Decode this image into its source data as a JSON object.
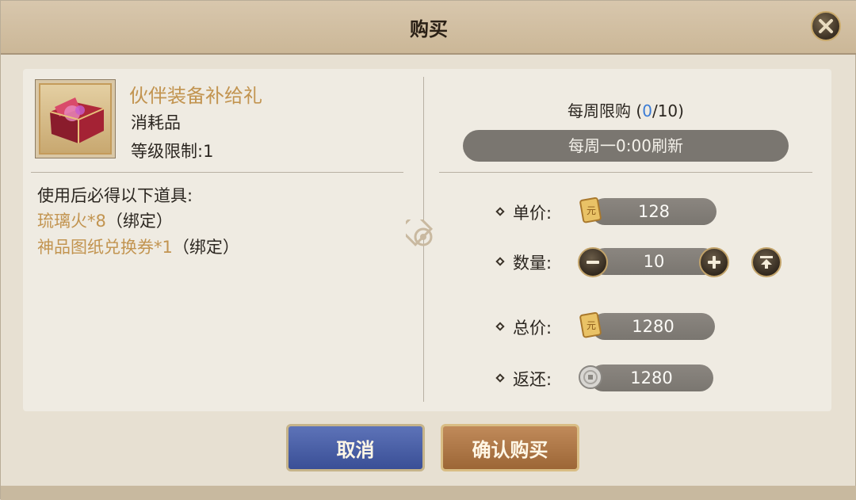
{
  "window": {
    "title": "购买"
  },
  "item": {
    "name": "伙伴装备补给礼",
    "type": "消耗品",
    "level_limit": "等级限制:1"
  },
  "rewards": {
    "heading": "使用后必得以下道具:",
    "items": [
      {
        "name": "琉璃火*8",
        "tag": "（绑定）"
      },
      {
        "name": "神品图纸兑换券*1",
        "tag": "（绑定）"
      }
    ]
  },
  "purchase_limit": {
    "label_prefix": "每周限购 (",
    "current": "0",
    "suffix": "/10)",
    "refresh_text": "每周一0:00刷新"
  },
  "fields": {
    "unit_price_label": "单价:",
    "unit_price": "128",
    "quantity_label": "数量:",
    "quantity": "10",
    "total_label": "总价:",
    "total": "1280",
    "rebate_label": "返还:",
    "rebate": "1280"
  },
  "buttons": {
    "cancel": "取消",
    "confirm": "确认购买"
  },
  "icons": {
    "close": "close-icon",
    "item": "treasure-chest-icon",
    "currency": "gold-scroll-icon",
    "rebate_currency": "silver-coin-icon",
    "minus": "minus-icon",
    "plus": "plus-icon",
    "max": "max-icon"
  },
  "colors": {
    "accent_gold": "#c29450",
    "limit_blue": "#3a7bd5",
    "cancel_blue": "#3a4f96",
    "confirm_brown": "#9c6636"
  }
}
